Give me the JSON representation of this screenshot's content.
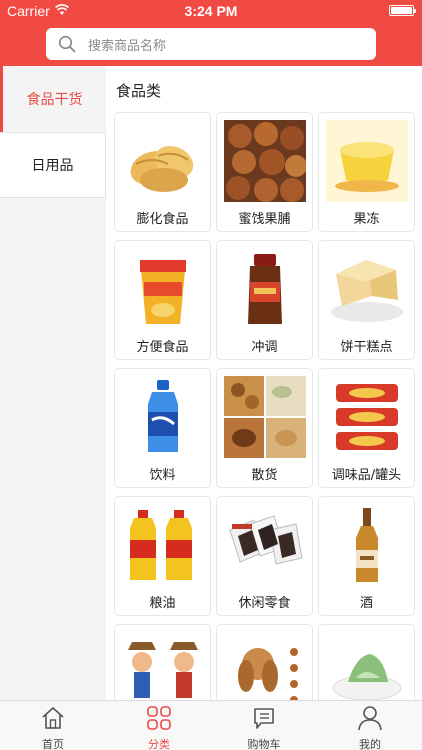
{
  "status_bar": {
    "carrier": "Carrier",
    "time": "3:24 PM"
  },
  "search": {
    "placeholder": "搜索商品名称"
  },
  "sidebar": {
    "items": [
      {
        "label": "食品干货",
        "active": true
      },
      {
        "label": "日用品",
        "active": false
      }
    ]
  },
  "main": {
    "section_title": "食品类",
    "items": [
      {
        "label": "膨化食品",
        "icon": "chips-icon"
      },
      {
        "label": "蜜饯果脯",
        "icon": "dried-fruit-icon"
      },
      {
        "label": "果冻",
        "icon": "jelly-icon"
      },
      {
        "label": "方便食品",
        "icon": "cup-noodle-icon"
      },
      {
        "label": "冲调",
        "icon": "drink-jar-icon"
      },
      {
        "label": "饼干糕点",
        "icon": "cake-icon"
      },
      {
        "label": "饮料",
        "icon": "bottle-icon"
      },
      {
        "label": "散货",
        "icon": "nuts-icon"
      },
      {
        "label": "调味品/罐头",
        "icon": "canned-fish-icon"
      },
      {
        "label": "粮油",
        "icon": "oil-bottle-icon"
      },
      {
        "label": "休闲零食",
        "icon": "snack-pack-icon"
      },
      {
        "label": "酒",
        "icon": "liquor-bottle-icon"
      },
      {
        "label": "",
        "icon": "cartoon-figures-icon"
      },
      {
        "label": "",
        "icon": "dog-icon"
      },
      {
        "label": "",
        "icon": "dessert-icon"
      }
    ]
  },
  "tabbar": {
    "tabs": [
      {
        "label": "首页",
        "icon": "home-icon",
        "active": false
      },
      {
        "label": "分类",
        "icon": "category-icon",
        "active": true
      },
      {
        "label": "购物车",
        "icon": "cart-icon",
        "active": false
      },
      {
        "label": "我的",
        "icon": "profile-icon",
        "active": false
      }
    ]
  },
  "colors": {
    "accent": "#f04a42",
    "active_text": "#e94b44",
    "background": "#f4f4f4"
  }
}
